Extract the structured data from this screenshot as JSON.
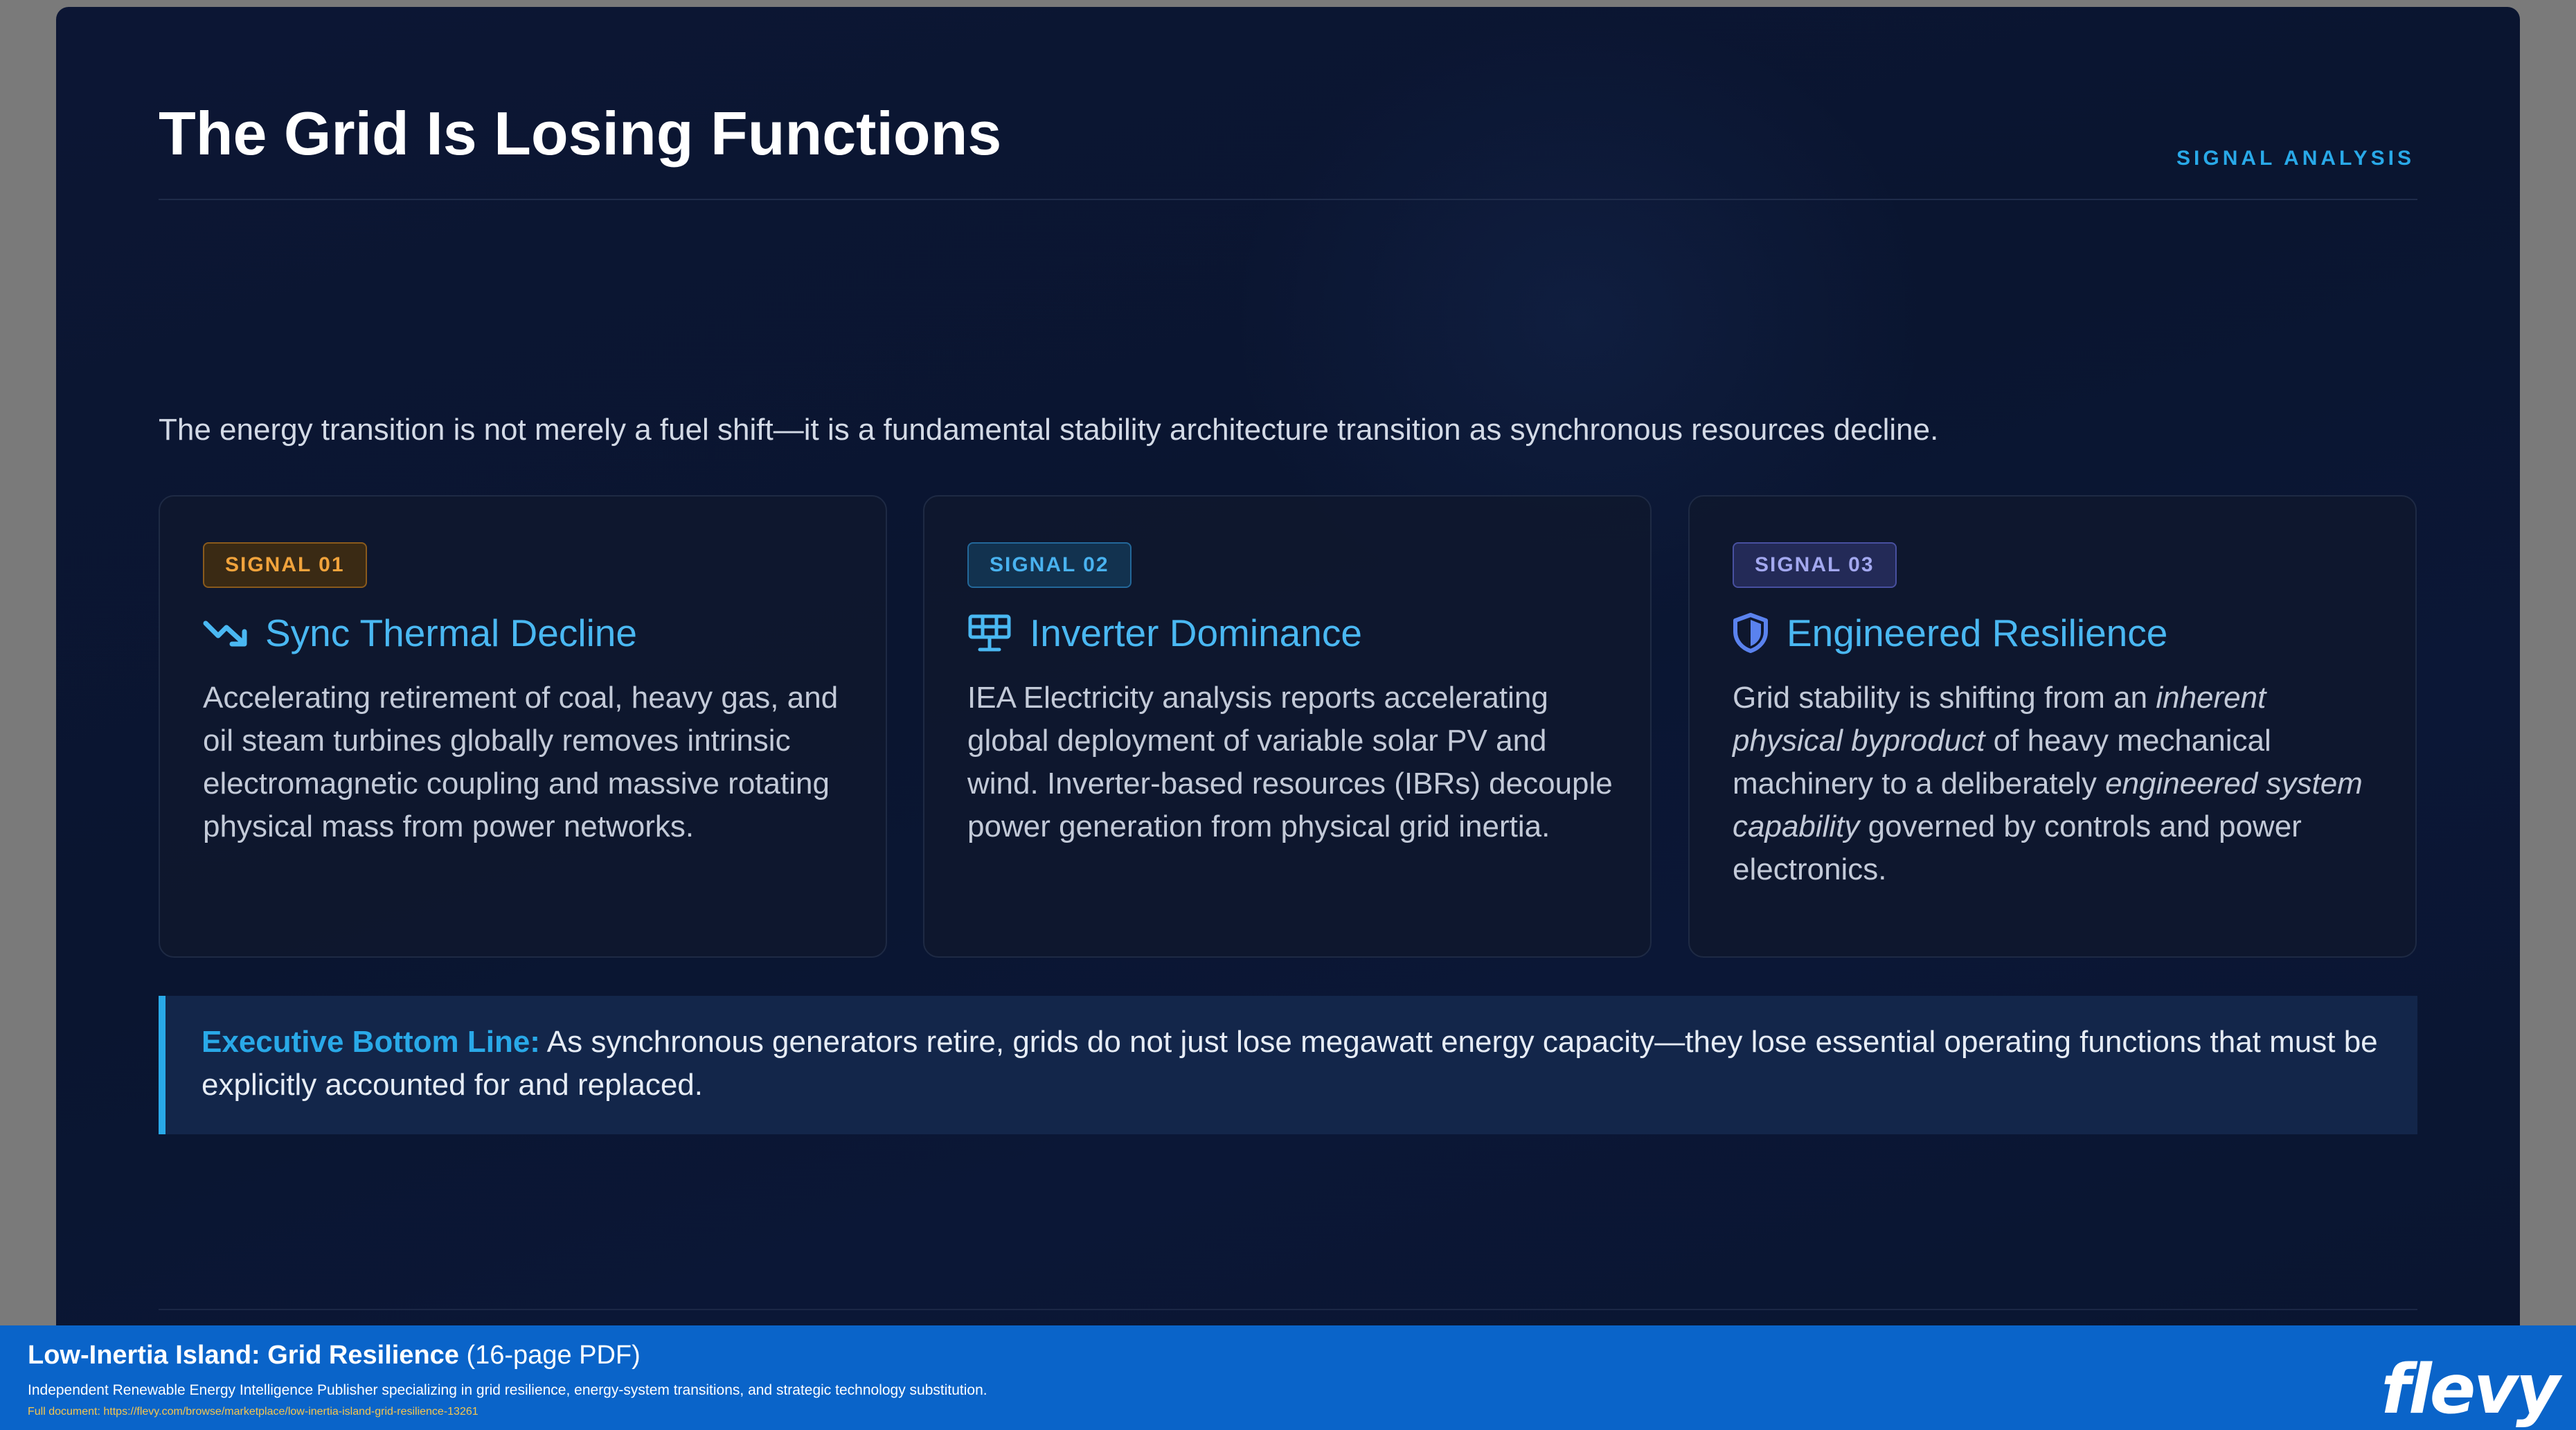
{
  "slide": {
    "title": "The Grid Is Losing Functions",
    "kicker": "SIGNAL ANALYSIS",
    "intro": "The energy transition is not merely a fuel shift—it is a fundamental stability architecture transition as synchronous resources decline."
  },
  "cards": [
    {
      "badge": "SIGNAL 01",
      "icon": "trending-down-icon",
      "title": "Sync Thermal Decline",
      "body": "Accelerating retirement of coal, heavy gas, and oil steam turbines globally removes intrinsic electromagnetic coupling and massive rotating physical mass from power networks."
    },
    {
      "badge": "SIGNAL 02",
      "icon": "solar-panel-icon",
      "title": "Inverter Dominance",
      "body": "IEA Electricity analysis reports accelerating global deployment of variable solar PV and wind. Inverter-based resources (IBRs) decouple power generation from physical grid inertia."
    },
    {
      "badge": "SIGNAL 03",
      "icon": "shield-icon",
      "title": "Engineered Resilience",
      "body_parts": [
        "Grid stability is shifting from an ",
        "inherent physical byproduct",
        " of heavy mechanical machinery to a deliberately ",
        "engineered system capability",
        " governed by controls and power electronics."
      ]
    }
  ],
  "bottom_line": {
    "label": "Executive Bottom Line:",
    "text": " As synchronous generators retire, grids do not just lose megawatt energy capacity—they lose essential operating functions that must be explicitly accounted for and replaced."
  },
  "footer": {
    "title": "Low-Inertia Island: Grid Resilience",
    "pages": " (16-page PDF)",
    "description": "Independent Renewable Energy Intelligence Publisher specializing in grid resilience, energy-system transitions, and strategic technology substitution.",
    "link": "Full document: https://flevy.com/browse/marketplace/low-inertia-island-grid-resilience-13261",
    "logo": "flevy"
  },
  "colors": {
    "accent": "#29a9e8",
    "background": "#0a1530",
    "footer": "#0a64c9"
  }
}
